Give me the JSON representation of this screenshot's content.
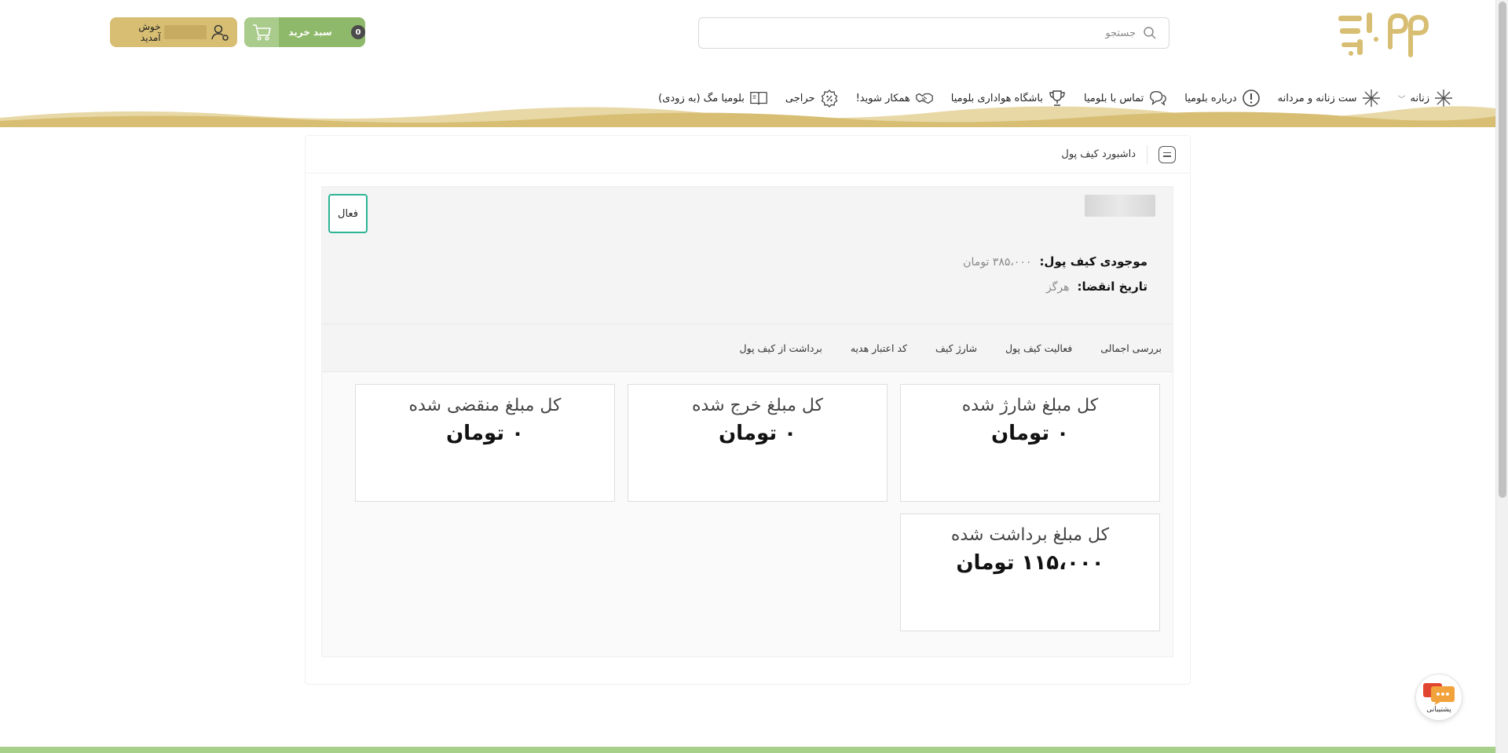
{
  "header": {
    "logo_text": "بلو میا",
    "search": {
      "placeholder": "جستجو"
    },
    "cart": {
      "label": "سبد خرید",
      "count": "0"
    },
    "user": {
      "greeting": "خوش آمدید"
    }
  },
  "nav": {
    "items": [
      {
        "label": "زنانه",
        "icon": "sparkle-icon",
        "has_dropdown": true
      },
      {
        "label": "ست زنانه و مردانه",
        "icon": "sparkle-icon"
      },
      {
        "label": "درباره بلومیا",
        "icon": "info-icon"
      },
      {
        "label": "تماس با بلومیا",
        "icon": "chat-icon"
      },
      {
        "label": "باشگاه هواداری بلومیا",
        "icon": "trophy-icon"
      },
      {
        "label": "همکار شوید!",
        "icon": "handshake-icon"
      },
      {
        "label": "حراجی",
        "icon": "discount-icon"
      },
      {
        "label": "بلومیا مگ (به زودی)",
        "icon": "book-icon"
      }
    ]
  },
  "dashboard": {
    "title": "داشبورد کیف پول",
    "status": "فعال",
    "balance_label": "موجودی کیف پول:",
    "balance_value": "۳۸۵،۰۰۰ تومان",
    "expiry_label": "تاریخ انقضا:",
    "expiry_value": "هرگز",
    "tabs": [
      "بررسی اجمالی",
      "فعالیت کیف پول",
      "شارژ کیف",
      "کد اعتبار هدیه",
      "برداشت از کیف پول"
    ],
    "cards": [
      {
        "label": "کل مبلغ شارژ شده",
        "value": "۰ تومان"
      },
      {
        "label": "کل مبلغ خرج شده",
        "value": "۰ تومان"
      },
      {
        "label": "کل مبلغ منقضی شده",
        "value": "۰ تومان"
      },
      {
        "label": "کل مبلغ برداشت شده",
        "value": "۱۱۵،۰۰۰ تومان"
      }
    ]
  },
  "support": {
    "label": "پشتیبانی"
  },
  "colors": {
    "brand_gold": "#d7be73",
    "cart_green": "#8fb96a",
    "status_teal": "#2cb594",
    "footer_green": "#a7d08a"
  }
}
